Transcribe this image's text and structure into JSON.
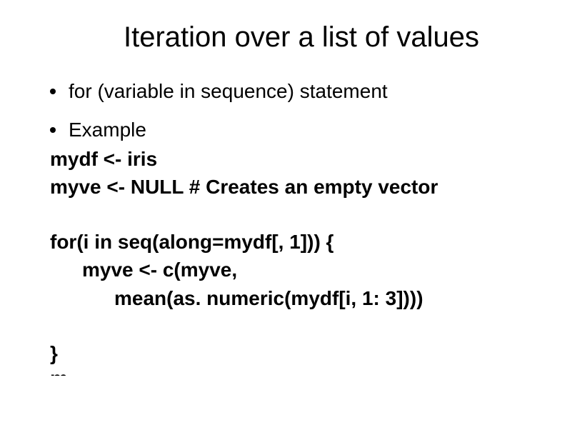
{
  "title": "Iteration over a list of values",
  "bullets": [
    "for (variable in sequence) statement",
    "Example"
  ],
  "code": {
    "line1": "mydf <- iris",
    "line2": "myve <- NULL # Creates an empty vector",
    "for1": "for(i in seq(along=mydf[, 1])) {",
    "for2": "myve <- c(myve,",
    "for3": "mean(as. numeric(mydf[i, 1: 3])))",
    "close": "}",
    "cutoff": "m"
  }
}
